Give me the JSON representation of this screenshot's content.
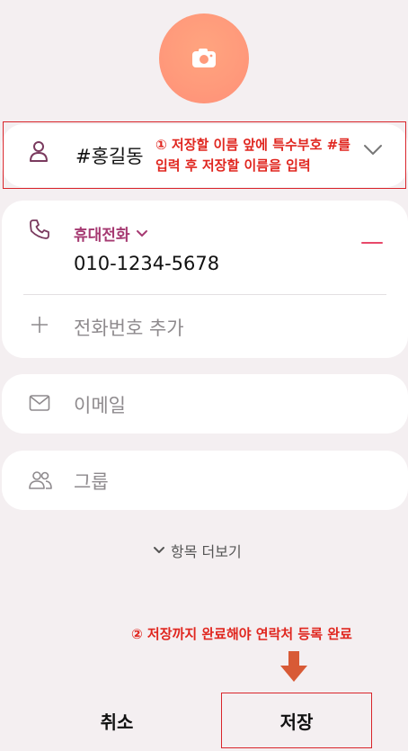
{
  "avatar": {
    "icon": "camera-icon"
  },
  "name_field": {
    "value": "#홍길동",
    "expand_icon": "chevron-down-icon"
  },
  "annotation_1": {
    "line1": "① 저장할 이름 앞에 특수부호 #를",
    "line2": "입력 후 저장할 이름을 입력"
  },
  "phone": {
    "type_label": "휴대전화",
    "number": "010-1234-5678",
    "add_label": "전화번호 추가"
  },
  "email": {
    "placeholder": "이메일"
  },
  "group": {
    "placeholder": "그룹"
  },
  "more_fields_label": "항목 더보기",
  "annotation_2": "② 저장까지 완료해야 연락처 등록 완료",
  "buttons": {
    "cancel": "취소",
    "save": "저장"
  },
  "colors": {
    "accent": "#a63a72",
    "remove": "#e8496a",
    "annotation": "#e0261f",
    "avatar": "#ff9a7b"
  }
}
